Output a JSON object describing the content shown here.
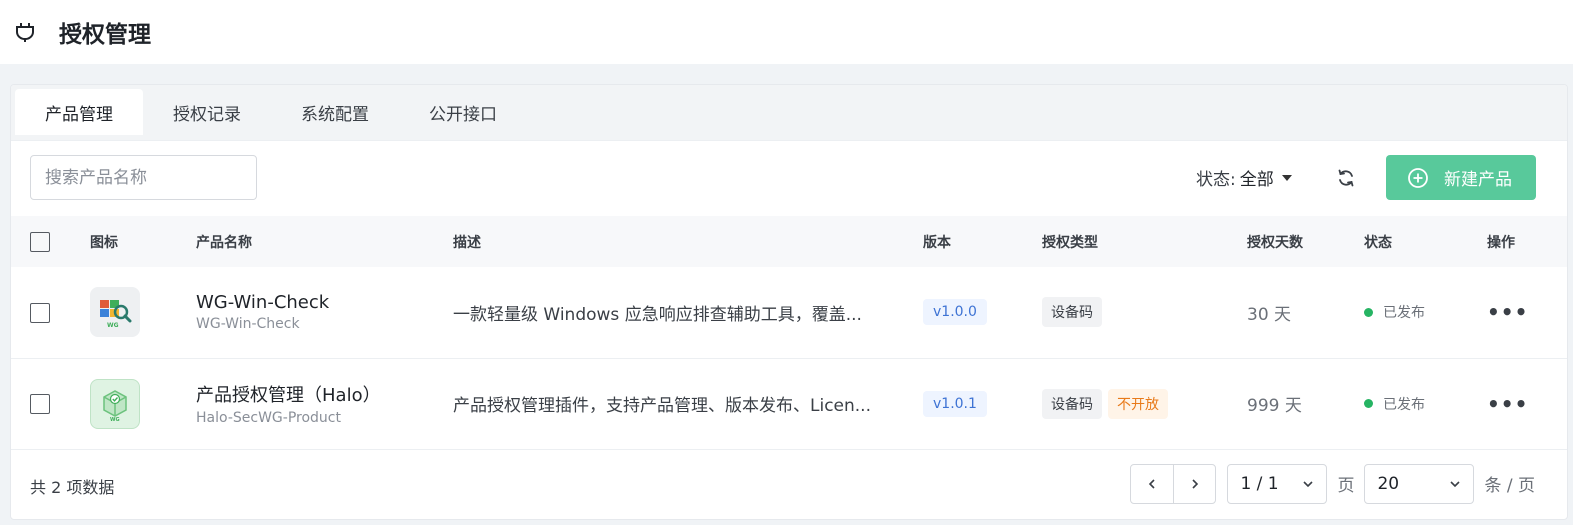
{
  "header": {
    "title": "授权管理",
    "icon": "plug-icon"
  },
  "tabs": [
    {
      "label": "产品管理",
      "active": true
    },
    {
      "label": "授权记录",
      "active": false
    },
    {
      "label": "系统配置",
      "active": false
    },
    {
      "label": "公开接口",
      "active": false
    }
  ],
  "toolbar": {
    "search_placeholder": "搜索产品名称",
    "status_label": "状态:",
    "status_value": "全部",
    "new_button": "新建产品"
  },
  "table": {
    "columns": [
      "图标",
      "产品名称",
      "描述",
      "版本",
      "授权类型",
      "授权天数",
      "状态",
      "操作"
    ],
    "rows": [
      {
        "name": "WG-Win-Check",
        "slug": "WG-Win-Check",
        "description": "一款轻量级 Windows 应急响应排查辅助工具，覆盖...",
        "version": "v1.0.0",
        "auth_type": "设备码",
        "auth_extra": "",
        "days": "30 天",
        "status": "已发布",
        "more": "•••"
      },
      {
        "name": "产品授权管理（Halo）",
        "slug": "Halo-SecWG-Product",
        "description": "产品授权管理插件，支持产品管理、版本发布、Licen...",
        "version": "v1.0.1",
        "auth_type": "设备码",
        "auth_extra": "不开放",
        "days": "999 天",
        "status": "已发布",
        "more": "•••"
      }
    ]
  },
  "footer": {
    "total": "共 2 项数据",
    "page": "1 / 1",
    "page_unit": "页",
    "page_size": "20",
    "size_unit": "条 / 页"
  },
  "colors": {
    "primary": "#58c99b",
    "published": "#26b463",
    "version_text": "#3e73d4",
    "not_open": "#e87a1a"
  }
}
